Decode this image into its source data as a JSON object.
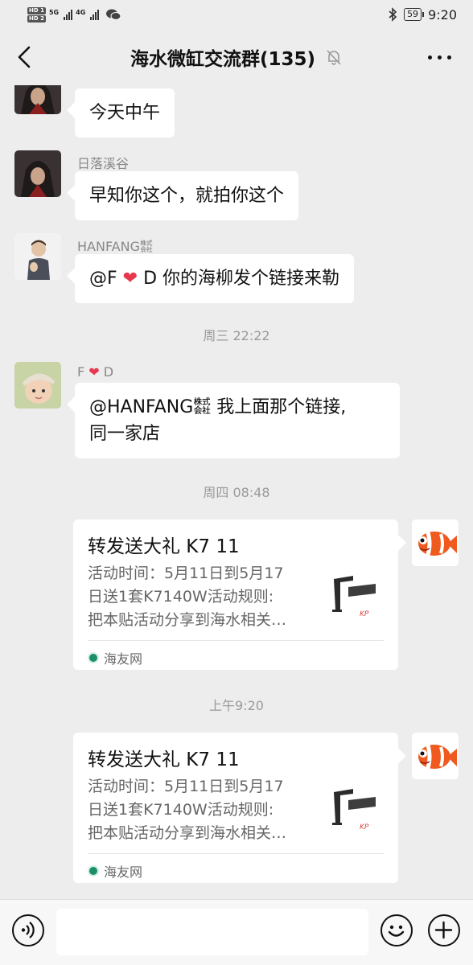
{
  "status": {
    "hd1": "HD 1",
    "hd2": "HD 2",
    "net1": "5G",
    "net2": "4G",
    "battery": "59",
    "time": "9:20"
  },
  "header": {
    "title": "海水微缸交流群(135)"
  },
  "messages": {
    "m1": {
      "text": "今天中午"
    },
    "m2": {
      "sender": "日落溪谷",
      "text": "早知你这个，就拍你这个"
    },
    "m3": {
      "sender": "HANFANG㍿",
      "text_a": "@F ",
      "text_b": "❤",
      "text_c": " D  你的海柳发个链接来勒"
    },
    "t1": "周三 22:22",
    "m4": {
      "sender_a": "F ",
      "sender_b": "❤",
      "sender_c": " D",
      "line1": "@HANFANG㍿ 我上面那个链接,",
      "line2": "同一家店"
    },
    "t2": "周四 08:48",
    "card1": {
      "title": "转发送大礼 K7 11",
      "desc1": "活动时间：5月11日到5月17",
      "desc2": "日送1套K7140W活动规则:",
      "desc3": "把本贴活动分享到海水相关…",
      "source": "海友网"
    },
    "t3": "上午9:20",
    "card2": {
      "title": "转发送大礼 K7 11",
      "desc1": "活动时间：5月11日到5月17",
      "desc2": "日送1套K7140W活动规则:",
      "desc3": "把本贴活动分享到海水相关…",
      "source": "海友网"
    }
  },
  "colors": {
    "background": "#ededed",
    "bubble": "#ffffff",
    "heart": "#e8384f",
    "meta_text": "#9a9a9a"
  },
  "icons": [
    "back-icon",
    "mute-bell-icon",
    "more-icon",
    "voice-icon",
    "emoji-icon",
    "plus-icon",
    "bluetooth-icon",
    "battery-icon",
    "wechat-icon"
  ]
}
